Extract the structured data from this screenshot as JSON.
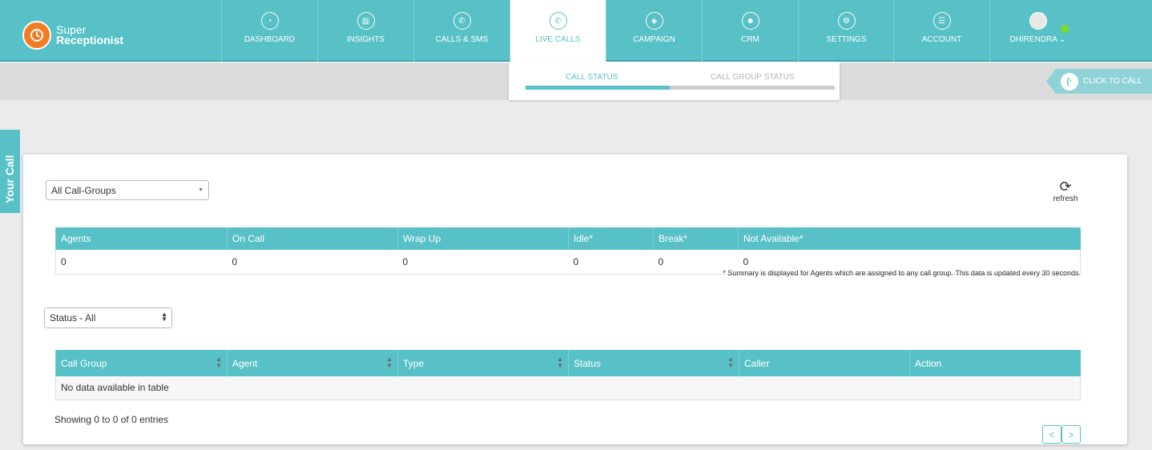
{
  "brand": {
    "line1": "Super",
    "line2": "Receptionist"
  },
  "nav": {
    "items": [
      {
        "label": "DASHBOARD",
        "icon": "dashboard-icon"
      },
      {
        "label": "INSIGHTS",
        "icon": "insights-icon"
      },
      {
        "label": "CALLS & SMS",
        "icon": "calls-icon"
      },
      {
        "label": "LIVE CALLS",
        "icon": "live-calls-icon",
        "active": true
      },
      {
        "label": "CAMPAIGN",
        "icon": "campaign-icon"
      },
      {
        "label": "CRM",
        "icon": "crm-icon"
      },
      {
        "label": "SETTINGS",
        "icon": "settings-icon"
      },
      {
        "label": "ACCOUNT",
        "icon": "account-icon"
      }
    ],
    "user": {
      "name": "DHIRENDRA",
      "status_color": "#7ddc1f"
    }
  },
  "subtabs": {
    "active": "CALL STATUS",
    "inactive": "CALL GROUP STATUS"
  },
  "click_to_call": "CLICK TO CALL",
  "side_tab": "Your Call",
  "filters": {
    "call_group": "All Call-Groups",
    "status": "Status - All"
  },
  "refresh_label": "refresh",
  "summary": {
    "headers": [
      "Agents",
      "On Call",
      "Wrap Up",
      "Idle*",
      "Break*",
      "Not Available*"
    ],
    "values": [
      "0",
      "0",
      "0",
      "0",
      "0",
      "0"
    ],
    "note": "* Summary is displayed for Agents which are assigned to any call group. This data is updated every 30 seconds."
  },
  "calls_table": {
    "headers": [
      "Call Group",
      "Agent",
      "Type",
      "Status",
      "Caller",
      "Action"
    ],
    "empty": "No data available in table",
    "info": "Showing 0 to 0 of 0 entries"
  },
  "pager": {
    "prev": "<",
    "next": ">"
  },
  "colors": {
    "accent": "#57c1c7",
    "brand_orange": "#f37b21"
  }
}
